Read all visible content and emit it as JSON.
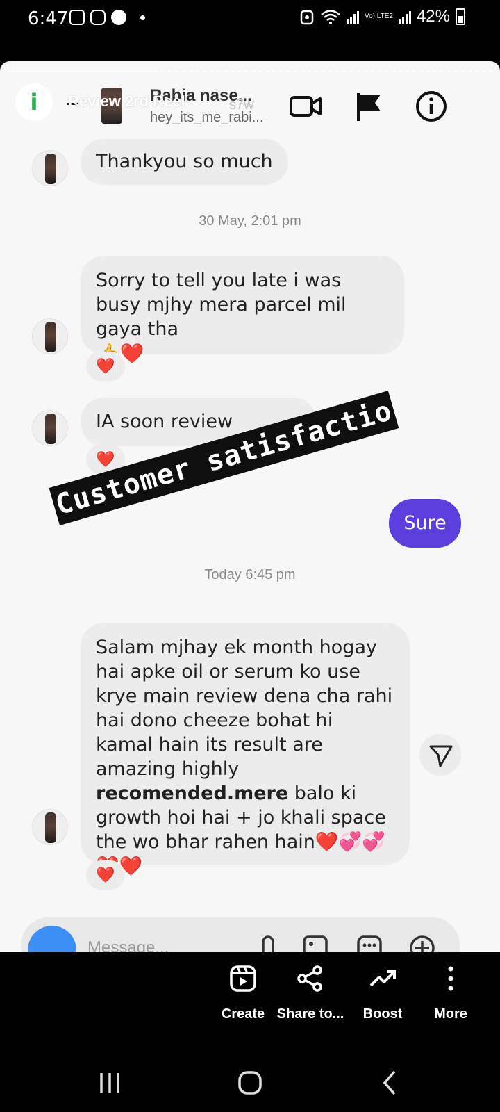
{
  "status_bar": {
    "time": "6:47",
    "battery": "42%",
    "network": "Vo) LTE2"
  },
  "story": {
    "title": "Review 2rd Reel",
    "progress": 0.31
  },
  "header": {
    "contact_name": "Rabia nase...",
    "username": "hey_its_me_rabi...",
    "faded_text": "s7w"
  },
  "messages": [
    {
      "sender": "them",
      "text": "Thankyou so much"
    },
    {
      "sender": "them",
      "text": "Sorry to tell you late i was busy mjhy mera parcel mil gaya tha",
      "emojis": "👍❤️",
      "reaction": "❤️"
    },
    {
      "sender": "them",
      "text": "IA soon review",
      "reaction": "❤️"
    },
    {
      "sender": "me",
      "text": "Sure"
    },
    {
      "sender": "them",
      "text_parts": [
        "Salam mjhay ek month hogay hai apke oil or serum ko use krye main review dena cha rahi hai dono cheeze bohat hi kamal hain its result are amazing highly ",
        "recomended.mere",
        " balo ki growth hoi hai + jo khali space the wo bhar rahen hain"
      ],
      "emojis_inline": "❤️💞💞",
      "emojis_line": "❤️❤️",
      "reaction": "❤️"
    }
  ],
  "timestamps": [
    "30 May, 2:01 pm",
    "Today 6:45 pm"
  ],
  "overlay_text": "Customer satisfactio",
  "composer": {
    "placeholder": "Message..."
  },
  "actions": [
    {
      "label": "Create",
      "icon": "reel-icon"
    },
    {
      "label": "Share to...",
      "icon": "share-icon"
    },
    {
      "label": "Boost",
      "icon": "trending-up-icon"
    },
    {
      "label": "More",
      "icon": "more-vertical-icon"
    }
  ],
  "colors": {
    "sent_bubble": "#5a3fdc",
    "received_bubble": "#ececec",
    "heart": "#e11d2a",
    "info_badge": "#2ab24a"
  }
}
